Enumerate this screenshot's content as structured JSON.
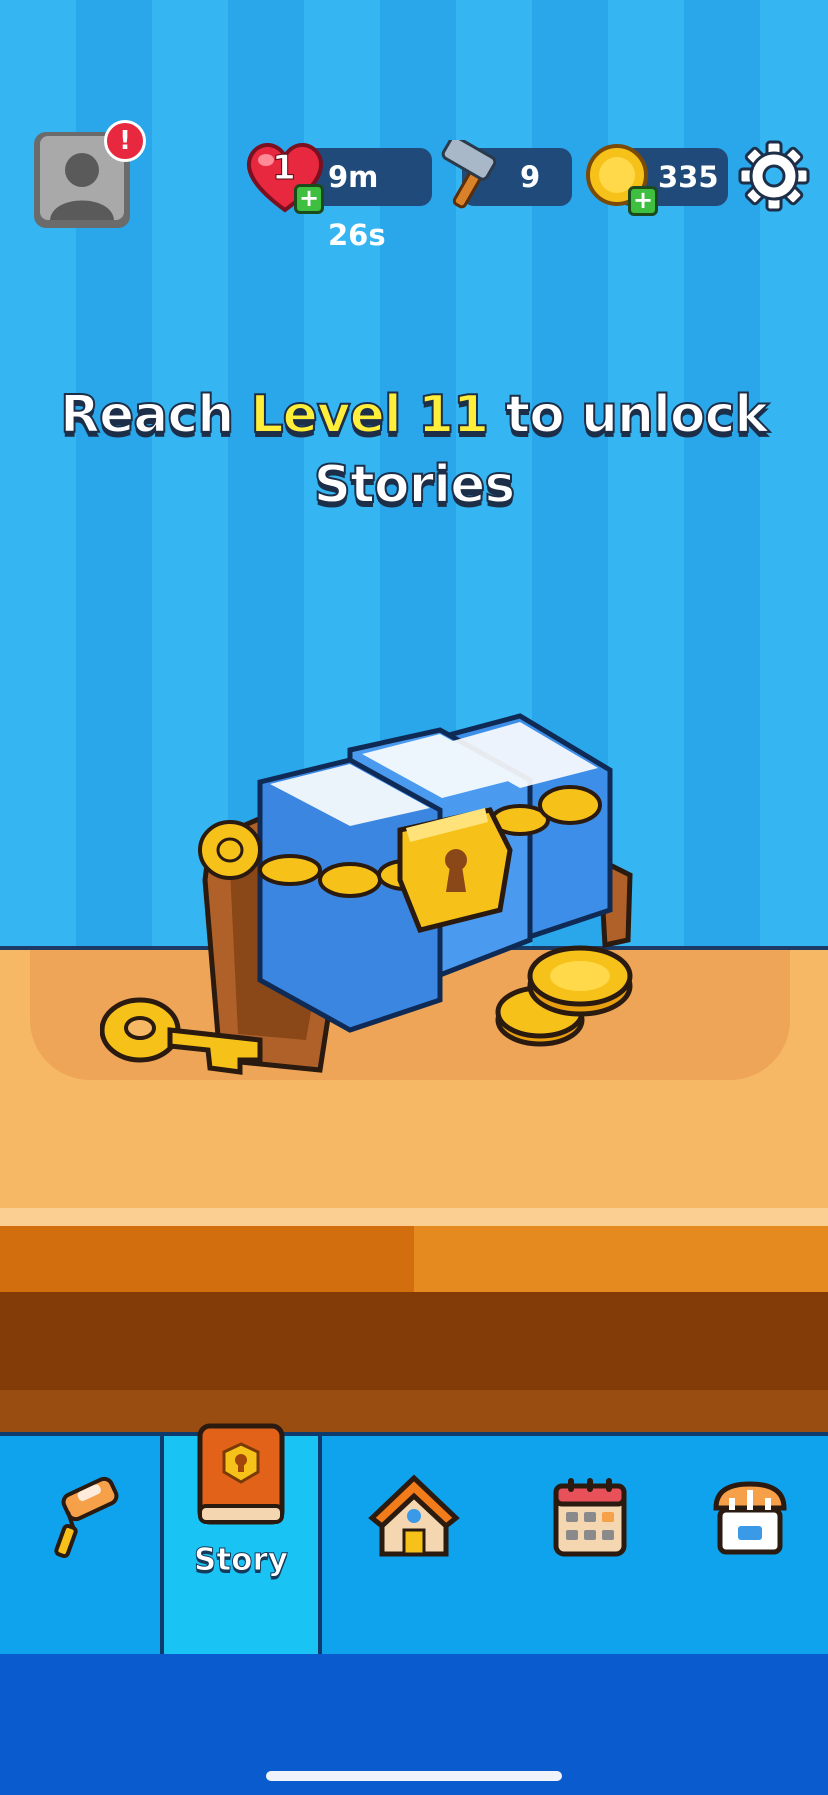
{
  "hud": {
    "lives_count": "1",
    "lives_timer": "9m 26s",
    "hammers": "9",
    "coins": "335",
    "profile_alert": "!"
  },
  "message": {
    "prefix": "Reach",
    "highlight": "Level 11",
    "suffix": "to unlock",
    "line2": "Stories"
  },
  "nav": {
    "items": [
      {
        "id": "decorate",
        "icon": "paint-roller-icon",
        "label": ""
      },
      {
        "id": "story",
        "icon": "story-book-icon",
        "label": "Story",
        "selected": true
      },
      {
        "id": "home",
        "icon": "house-icon",
        "label": ""
      },
      {
        "id": "events",
        "icon": "calendar-icon",
        "label": ""
      },
      {
        "id": "shop",
        "icon": "shop-icon",
        "label": ""
      }
    ]
  },
  "colors": {
    "wall": "#35b6f3",
    "nav_bar": "#0fa3ee",
    "nav_selected": "#19c4f4",
    "highlight_text": "#ffef3a",
    "table": "#f7b866"
  }
}
